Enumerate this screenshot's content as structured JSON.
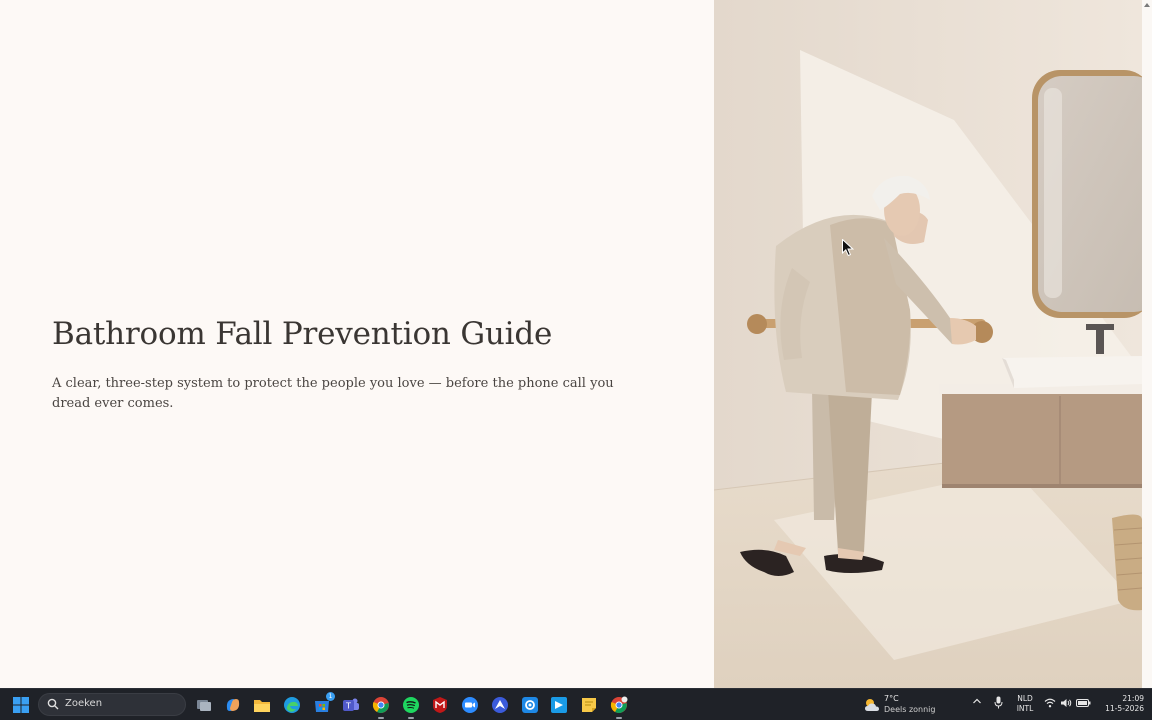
{
  "hero": {
    "title": "Bathroom Fall Prevention Guide",
    "subtitle": "A clear, three-step system to protect the people you love — before the phone call you dread ever comes."
  },
  "image": {
    "subject": "elderly-man-holding-bathroom-grab-bar"
  },
  "taskbar": {
    "search_placeholder": "Zoeken",
    "apps": [
      "windows-start-icon",
      "task-view-icon",
      "copilot-icon",
      "file-explorer-icon",
      "edge-icon",
      "store-icon",
      "teams-icon",
      "chrome-icon",
      "spotify-icon",
      "mcafee-icon",
      "zoom-icon",
      "vpn-icon",
      "settings-icon",
      "app-icon",
      "sticky-notes-icon",
      "chrome-profile-icon"
    ],
    "store_badge": "1",
    "weather": {
      "temp": "7°C",
      "condition": "Deels zonnig"
    },
    "language": {
      "line1": "NLD",
      "line2": "INTL"
    },
    "clock": {
      "time": "21:09",
      "date": "11-5-2026"
    }
  },
  "colors": {
    "background": "#fdf9f6",
    "text": "#3a3633",
    "taskbar": "#1f2228",
    "brass": "#c9a070"
  }
}
